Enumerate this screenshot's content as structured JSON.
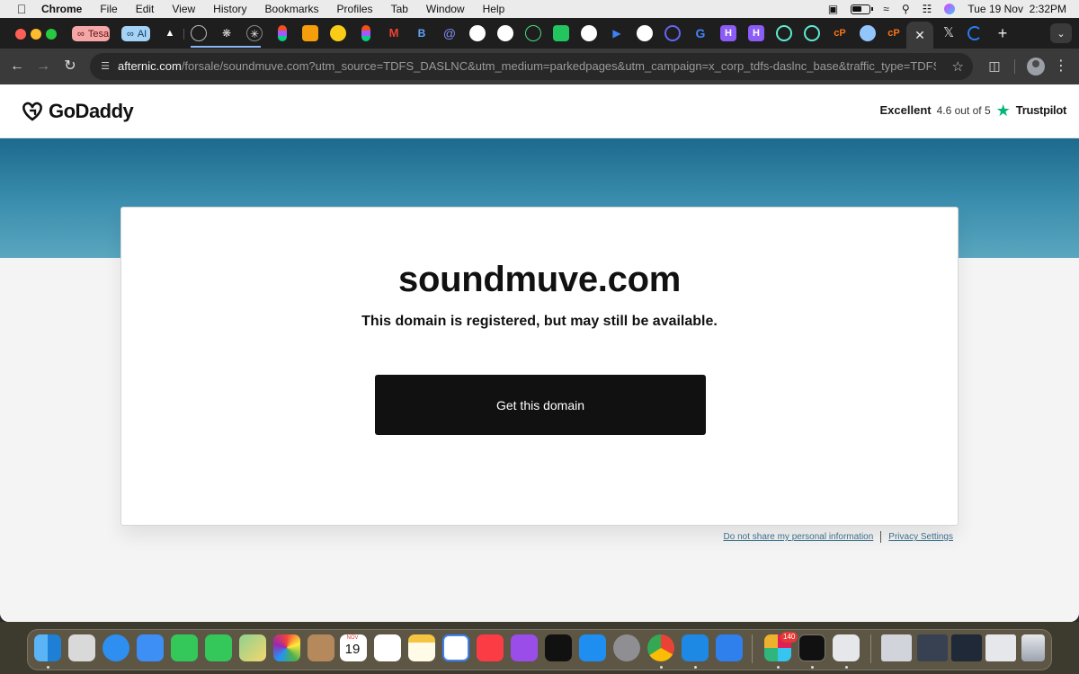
{
  "menubar": {
    "app_name": "Chrome",
    "items": [
      "File",
      "Edit",
      "View",
      "History",
      "Bookmarks",
      "Profiles",
      "Tab",
      "Window",
      "Help"
    ],
    "clock": "Tue 19 Nov  2:32PM"
  },
  "tabs": {
    "group_tesa": "Tesa",
    "group_ai": "AI"
  },
  "toolbar": {
    "url_host": "afternic.com",
    "url_path": "/forsale/soundmuve.com?utm_source=TDFS_DASLNC&utm_medium=parkedpages&utm_campaign=x_corp_tdfs-daslnc_base&traffic_type=TDFS_DAS..."
  },
  "header": {
    "logo_text": "GoDaddy",
    "trust_rating": "Excellent",
    "trust_score": "4.6 out of 5",
    "trust_brand": "Trustpilot"
  },
  "main": {
    "domain": "soundmuve.com",
    "subtitle": "This domain is registered, but may still be available.",
    "cta_label": "Get this domain"
  },
  "footer": {
    "privacy_optout": "Do not share my personal information",
    "privacy_settings": "Privacy Settings"
  },
  "dock": {
    "calendar_month": "NOV",
    "calendar_day": "19",
    "slack_badge": "140"
  },
  "colors": {
    "hero_band": "#3c8fae",
    "cta_background": "#111111",
    "trustpilot_green": "#00b67a"
  }
}
